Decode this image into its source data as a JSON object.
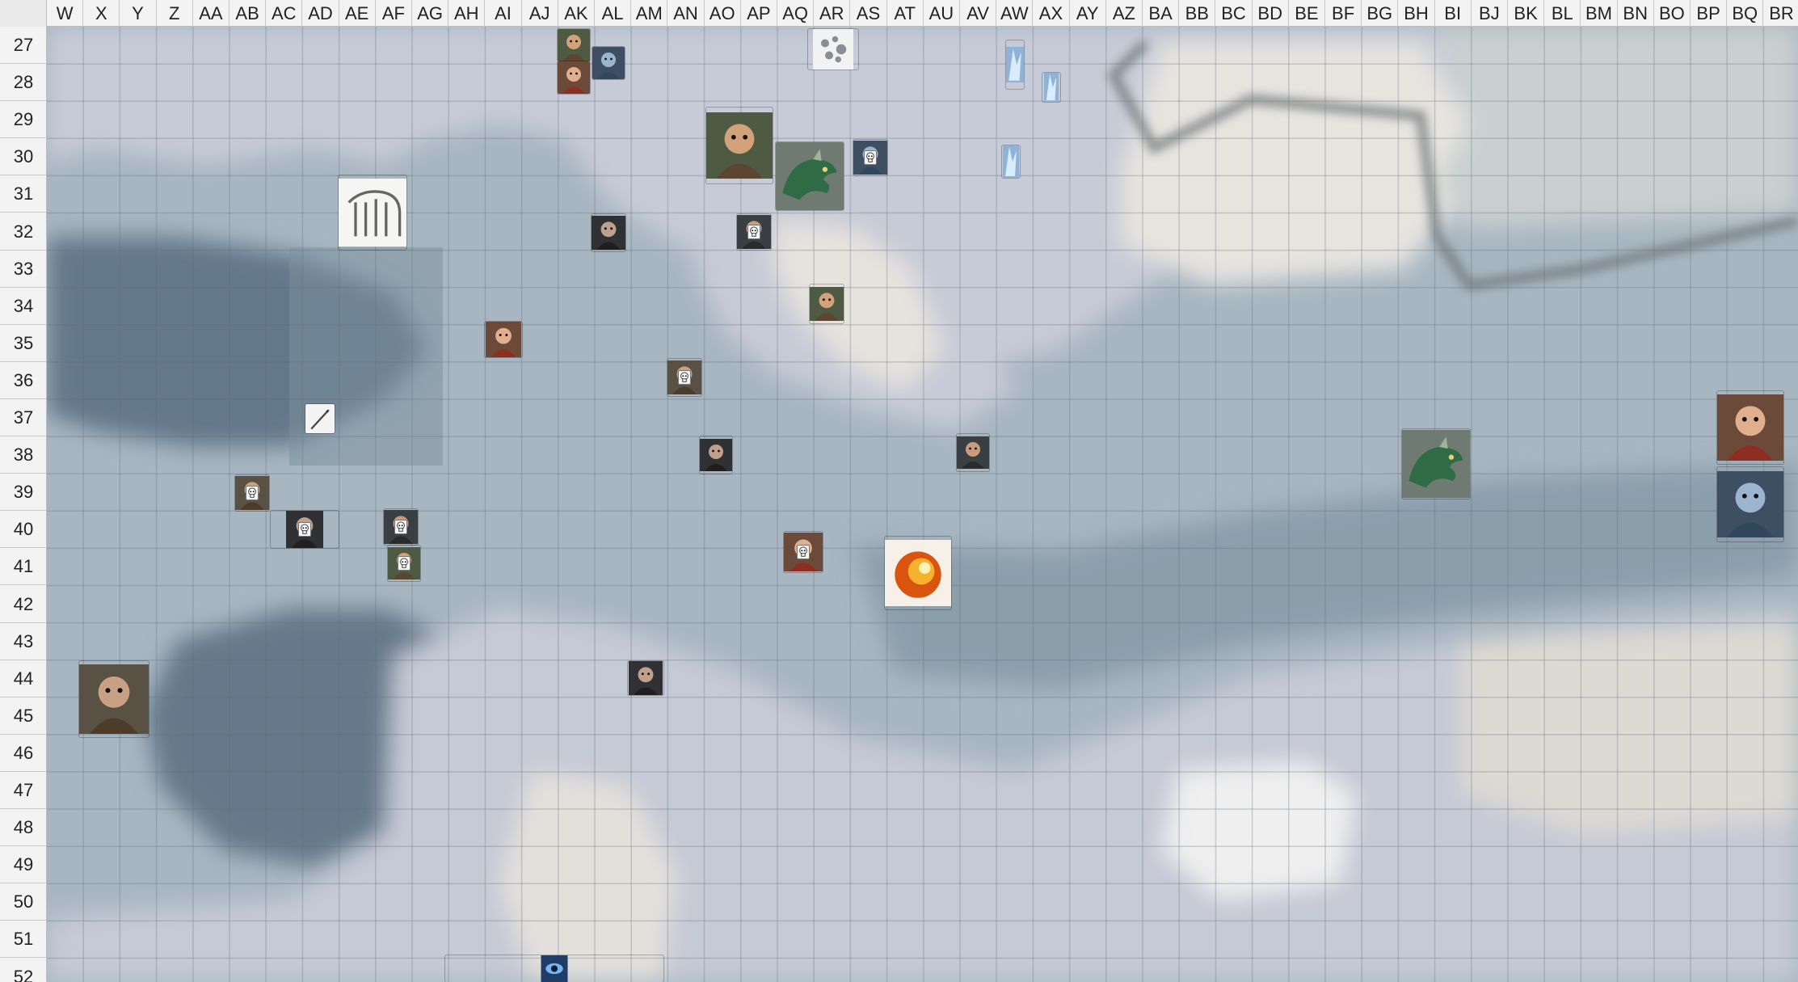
{
  "columns": [
    "W",
    "X",
    "Y",
    "Z",
    "AA",
    "AB",
    "AC",
    "AD",
    "AE",
    "AF",
    "AG",
    "AH",
    "AI",
    "AJ",
    "AK",
    "AL",
    "AM",
    "AN",
    "AO",
    "AP",
    "AQ",
    "AR",
    "AS",
    "AT",
    "AU",
    "AV",
    "AW",
    "AX",
    "AY",
    "AZ",
    "BA",
    "BB",
    "BC",
    "BD",
    "BE",
    "BF",
    "BG",
    "BH",
    "BI",
    "BJ",
    "BK",
    "BL",
    "BM",
    "BN",
    "BO",
    "BP",
    "BQ",
    "BR"
  ],
  "rows": [
    "27",
    "28",
    "29",
    "30",
    "31",
    "32",
    "33",
    "34",
    "35",
    "36",
    "37",
    "38",
    "39",
    "40",
    "41",
    "42",
    "43",
    "44",
    "45",
    "46",
    "47",
    "48",
    "49",
    "50",
    "51",
    "52"
  ],
  "colors": {
    "header_bg": "#f3f3f3",
    "gridline": "#5d6a75",
    "water_dark": "#5f7382",
    "water_mid": "#8fa0ad",
    "ice_light": "#c9cdd9",
    "snow": "#e6e3df"
  },
  "tokens": [
    {
      "name": "rubble-token",
      "icon": "rubble-icon"
    },
    {
      "name": "human-fighter-token-1",
      "icon": "portrait-icon"
    },
    {
      "name": "human-fighter-token-2",
      "icon": "portrait-icon"
    },
    {
      "name": "human-fighter-token-3",
      "icon": "portrait-icon"
    },
    {
      "name": "ice-shard-token-1",
      "icon": "ice-icon"
    },
    {
      "name": "ice-shard-token-2",
      "icon": "ice-icon"
    },
    {
      "name": "ice-shard-token-3",
      "icon": "ice-icon"
    },
    {
      "name": "horned-orc-token",
      "icon": "portrait-icon"
    },
    {
      "name": "green-dragon-token-1",
      "icon": "dragon-icon"
    },
    {
      "name": "bearded-mage-token",
      "icon": "portrait-icon"
    },
    {
      "name": "sketched-beast-token",
      "icon": "beast-sketch-icon"
    },
    {
      "name": "dwarf-token",
      "icon": "portrait-icon"
    },
    {
      "name": "barbarian-token",
      "icon": "portrait-icon"
    },
    {
      "name": "elf-archer-token",
      "icon": "portrait-icon"
    },
    {
      "name": "hooded-rogue-token",
      "icon": "portrait-icon"
    },
    {
      "name": "spear-token",
      "icon": "spear-icon"
    },
    {
      "name": "wide-hat-hunter-token",
      "icon": "portrait-icon"
    },
    {
      "name": "dark-warrior-token",
      "icon": "portrait-icon"
    },
    {
      "name": "dead-red-cloak-token",
      "icon": "portrait-icon"
    },
    {
      "name": "green-dragon-token-2",
      "icon": "dragon-icon"
    },
    {
      "name": "frost-giant-token-1",
      "icon": "portrait-icon"
    },
    {
      "name": "frost-giant-token-2",
      "icon": "portrait-icon"
    },
    {
      "name": "red-haired-corpse-token",
      "icon": "portrait-icon"
    },
    {
      "name": "corpse-token-1",
      "icon": "portrait-icon"
    },
    {
      "name": "corpse-token-2",
      "icon": "portrait-icon"
    },
    {
      "name": "corpse-token-3",
      "icon": "portrait-icon"
    },
    {
      "name": "corpse-token-4",
      "icon": "portrait-icon"
    },
    {
      "name": "fire-orb-token",
      "icon": "fire-icon"
    },
    {
      "name": "ogre-token",
      "icon": "portrait-icon"
    },
    {
      "name": "goblin-token",
      "icon": "portrait-icon"
    },
    {
      "name": "blue-eye-token",
      "icon": "eye-icon"
    },
    {
      "name": "glacier-token",
      "icon": "glacier-icon"
    }
  ]
}
